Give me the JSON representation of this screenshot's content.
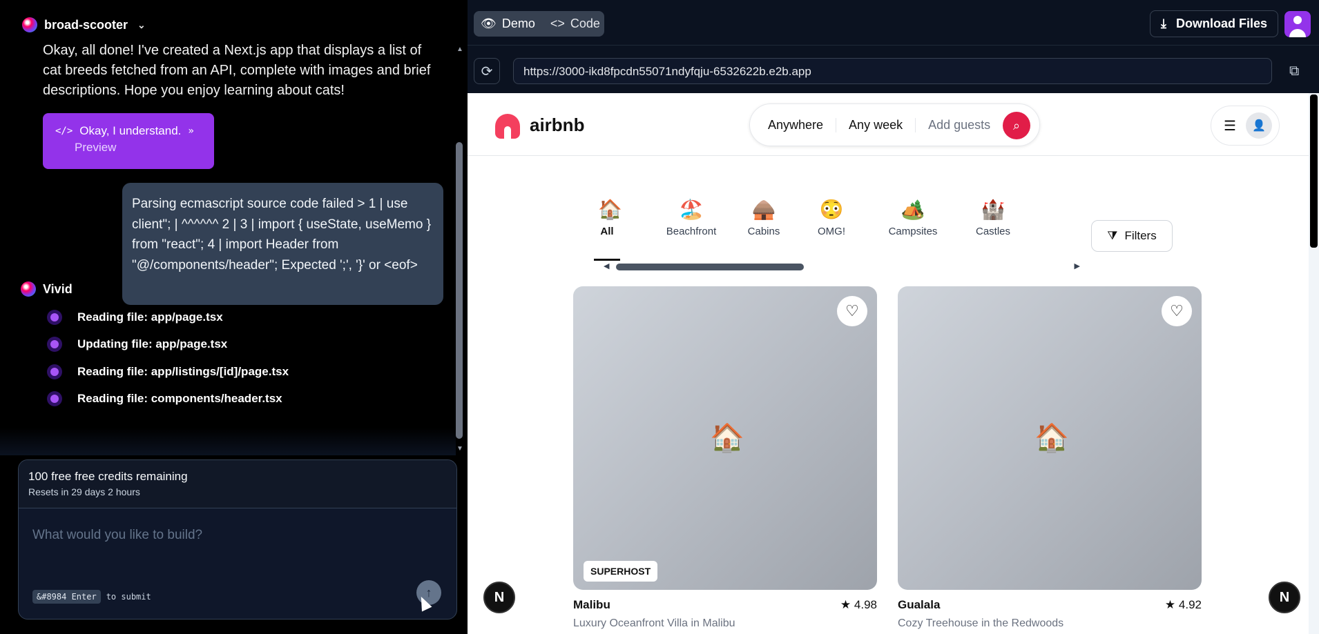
{
  "left_panel": {
    "project_name": "broad-scooter",
    "ai_message": "Okay, all done! I've created a Next.js app that displays a list of cat breeds fetched from an API, complete with images and brief descriptions. Hope you enjoy learning about cats!",
    "preview_card": {
      "title": "Okay, I understand.",
      "subtitle": "Preview"
    },
    "user_message": "Parsing ecmascript source code failed > 1 | use client\"; | ^^^^^^ 2 | 3 | import { useState, useMemo } from \"react\"; 4 | import Header from \"@/components/header\"; Expected ';', '}' or <eof>",
    "assistant_name": "Vivid",
    "steps": [
      {
        "label": "Reading file: app/page.tsx"
      },
      {
        "label": "Updating file: app/page.tsx"
      },
      {
        "label": "Reading file: app/listings/[id]/page.tsx"
      },
      {
        "label": "Reading file: components/header.tsx"
      }
    ],
    "credits": {
      "remaining": "100 free free credits remaining",
      "resets": "Resets in 29 days 2 hours"
    },
    "prompt_placeholder": "What would you like to build?",
    "submit_hint": {
      "key": "&#8984 Enter",
      "text": "to submit"
    }
  },
  "right_panel": {
    "tabs": [
      {
        "label": "Demo",
        "icon": "eye-icon"
      },
      {
        "label": "Code",
        "icon": "code-icon"
      }
    ],
    "download_label": "Download Files",
    "url": "https://3000-ikd8fpcdn55071ndyfqju-6532622b.e2b.app",
    "site": {
      "brand": "airbnb",
      "search": {
        "where": "Anywhere",
        "when": "Any week",
        "guests": "Add guests"
      },
      "categories": [
        {
          "label": "All",
          "emoji": "🏠",
          "active": true
        },
        {
          "label": "Beachfront",
          "emoji": "🏖️"
        },
        {
          "label": "Cabins",
          "emoji": "🛖"
        },
        {
          "label": "OMG!",
          "emoji": "😳"
        },
        {
          "label": "Campsites",
          "emoji": "🏕️"
        },
        {
          "label": "Castles",
          "emoji": "🏰"
        }
      ],
      "filters_label": "Filters",
      "listings": [
        {
          "location": "Malibu",
          "rating": "4.98",
          "title": "Luxury Oceanfront Villa in Malibu",
          "badge": "SUPERHOST"
        },
        {
          "location": "Gualala",
          "rating": "4.92",
          "title": "Cozy Treehouse in the Redwoods"
        }
      ]
    }
  },
  "colors": {
    "accent": "#9333ea",
    "brand": "#e11d48"
  }
}
